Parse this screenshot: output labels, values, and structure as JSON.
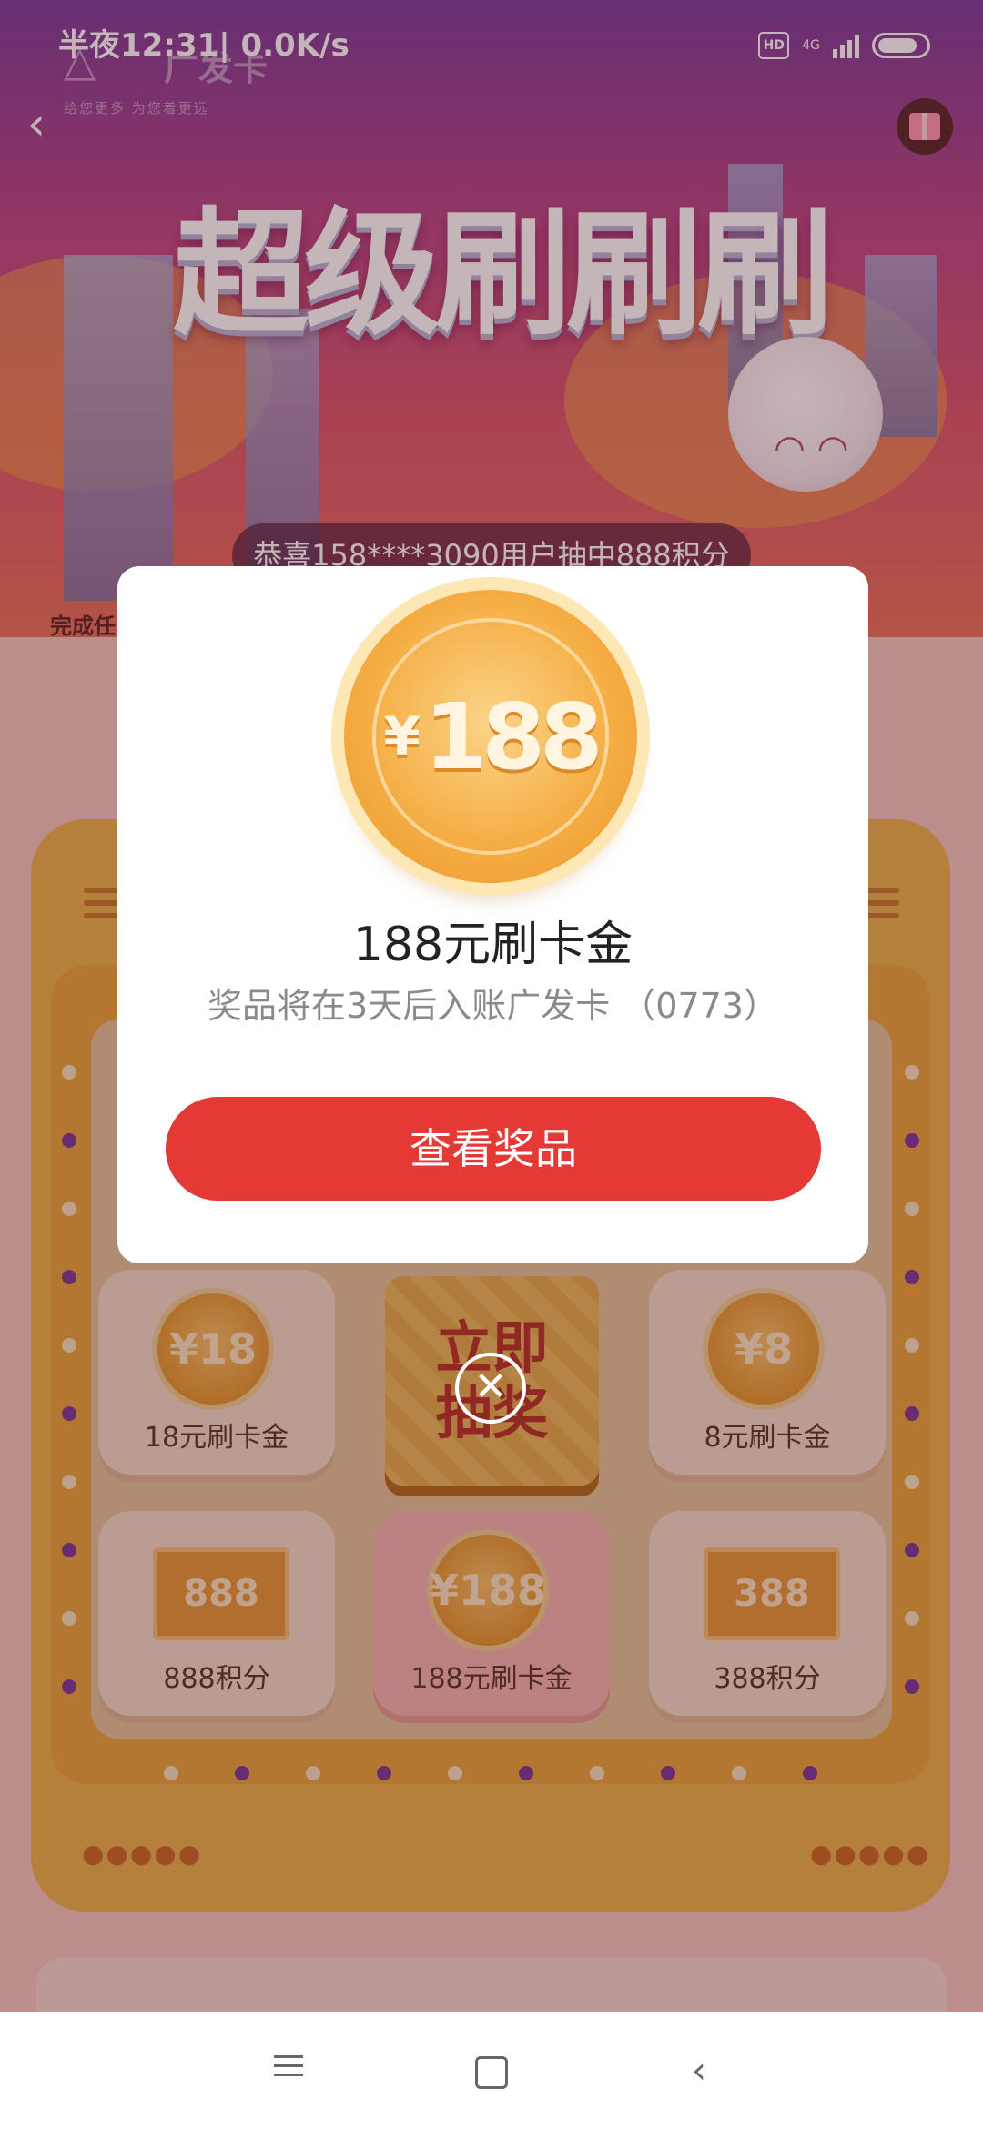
{
  "status_bar": {
    "time_speed": "半夜12:31| 0.0K/s",
    "hd": "HD",
    "network": "4G"
  },
  "header": {
    "logo_text": "广发卡",
    "logo_sub": "给您更多 为您着更远",
    "hero_title": "超级刷刷刷",
    "ticker": "恭喜158****3090用户抽中888积分",
    "task_label": "完成任"
  },
  "board": {
    "cells": [
      {
        "face": "¥18",
        "label": "18元刷卡金"
      },
      {
        "face": "¥8",
        "label": "8元刷卡金"
      },
      {
        "face": "888",
        "label": "888积分"
      },
      {
        "face": "¥188",
        "label": "188元刷卡金"
      },
      {
        "face": "388",
        "label": "388积分"
      }
    ],
    "draw_button": "立即抽奖"
  },
  "modal": {
    "coin_yen": "¥",
    "coin_amount": "188",
    "title": "188元刷卡金",
    "description": "奖品将在3天后入账广发卡 （0773）",
    "button": "查看奖品",
    "close_symbol": "✕"
  },
  "colors": {
    "accent_red": "#e53935",
    "coin_gold": "#f5ae45"
  },
  "icons": [
    "back-icon",
    "gift-icon",
    "close-icon",
    "menu-icon",
    "home-icon",
    "nav-back-icon"
  ]
}
